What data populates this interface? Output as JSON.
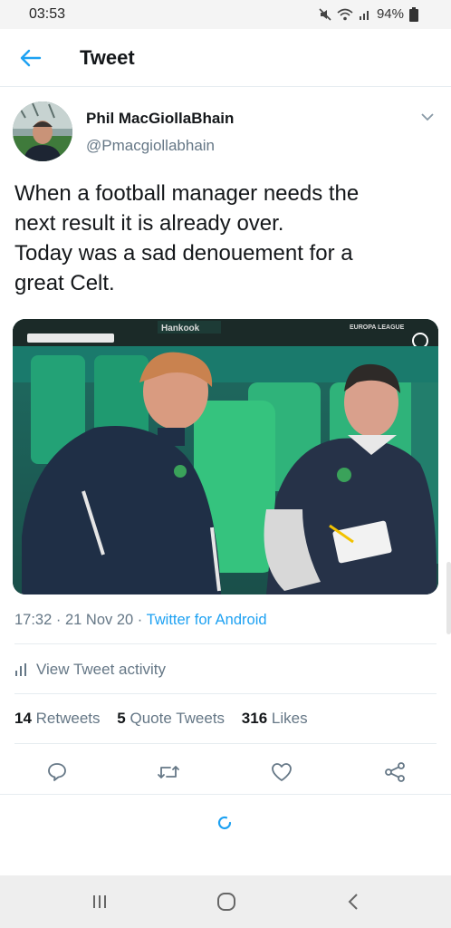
{
  "status_bar": {
    "time": "03:53",
    "battery": "94%"
  },
  "header": {
    "title": "Tweet",
    "back_icon": "arrow-left-icon"
  },
  "tweet": {
    "author_name": "Phil MacGiollaBhain",
    "author_handle": "@Pmacgiollabhain",
    "text_lines": [
      "When a football manager needs the",
      "next result it is already over.",
      "Today was a sad denouement for a",
      "great Celt."
    ],
    "media": {
      "board_text": "Hankook",
      "broadcast_logo": "EUROPA LEAGUE"
    },
    "time": "17:32",
    "date": "21 Nov 20",
    "source": "Twitter for Android"
  },
  "activity": {
    "label": "View Tweet activity"
  },
  "stats": {
    "retweets_count": "14",
    "retweets_label": "Retweets",
    "quotes_count": "5",
    "quotes_label": "Quote Tweets",
    "likes_count": "316",
    "likes_label": "Likes"
  },
  "colors": {
    "accent": "#1da1f2",
    "secondary_text": "#657786",
    "primary_text": "#14171a",
    "divider": "#e6ecf0"
  }
}
